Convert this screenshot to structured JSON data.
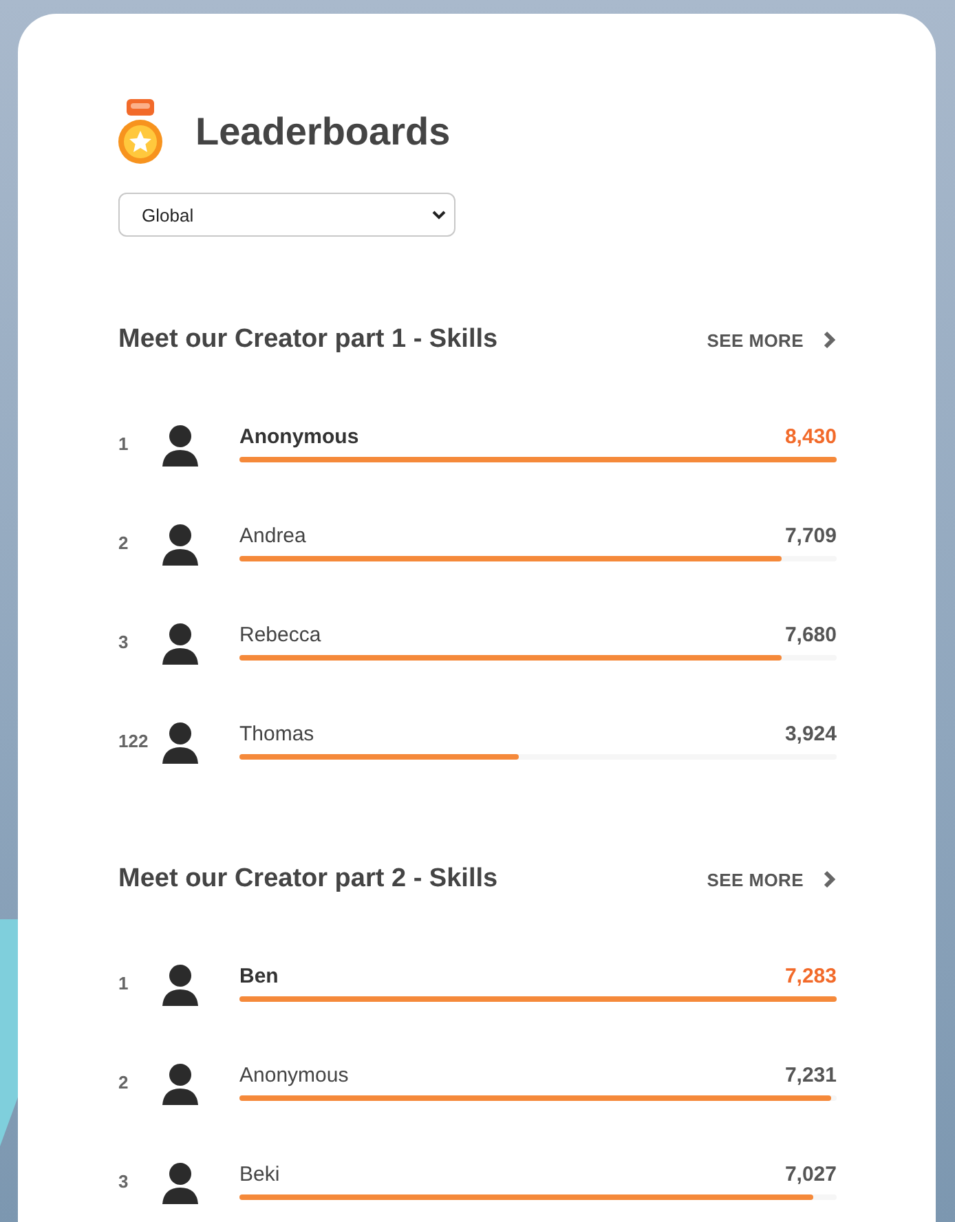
{
  "header": {
    "title": "Leaderboards"
  },
  "scope_select": {
    "value": "Global"
  },
  "boards": [
    {
      "title": "Meet our Creator part 1 - Skills",
      "see_more": "SEE MORE",
      "entries": [
        {
          "rank": "1",
          "name": "Anonymous",
          "score": "8,430",
          "level": 1,
          "highlighted": true
        },
        {
          "rank": "2",
          "name": "Andrea",
          "score": "7,709",
          "level": 0.908,
          "highlighted": false
        },
        {
          "rank": "3",
          "name": "Rebecca",
          "score": "7,680",
          "level": 0.908,
          "highlighted": false
        },
        {
          "rank": "122",
          "name": "Thomas",
          "score": "3,924",
          "level": 0.468,
          "highlighted": false
        }
      ]
    },
    {
      "title": "Meet our Creator part 2 - Skills",
      "see_more": "SEE MORE",
      "entries": [
        {
          "rank": "1",
          "name": "Ben",
          "score": "7,283",
          "level": 1,
          "highlighted": true
        },
        {
          "rank": "2",
          "name": "Anonymous",
          "score": "7,231",
          "level": 0.99,
          "highlighted": false
        },
        {
          "rank": "3",
          "name": "Beki",
          "score": "7,027",
          "level": 0.96,
          "highlighted": false
        }
      ]
    }
  ]
}
